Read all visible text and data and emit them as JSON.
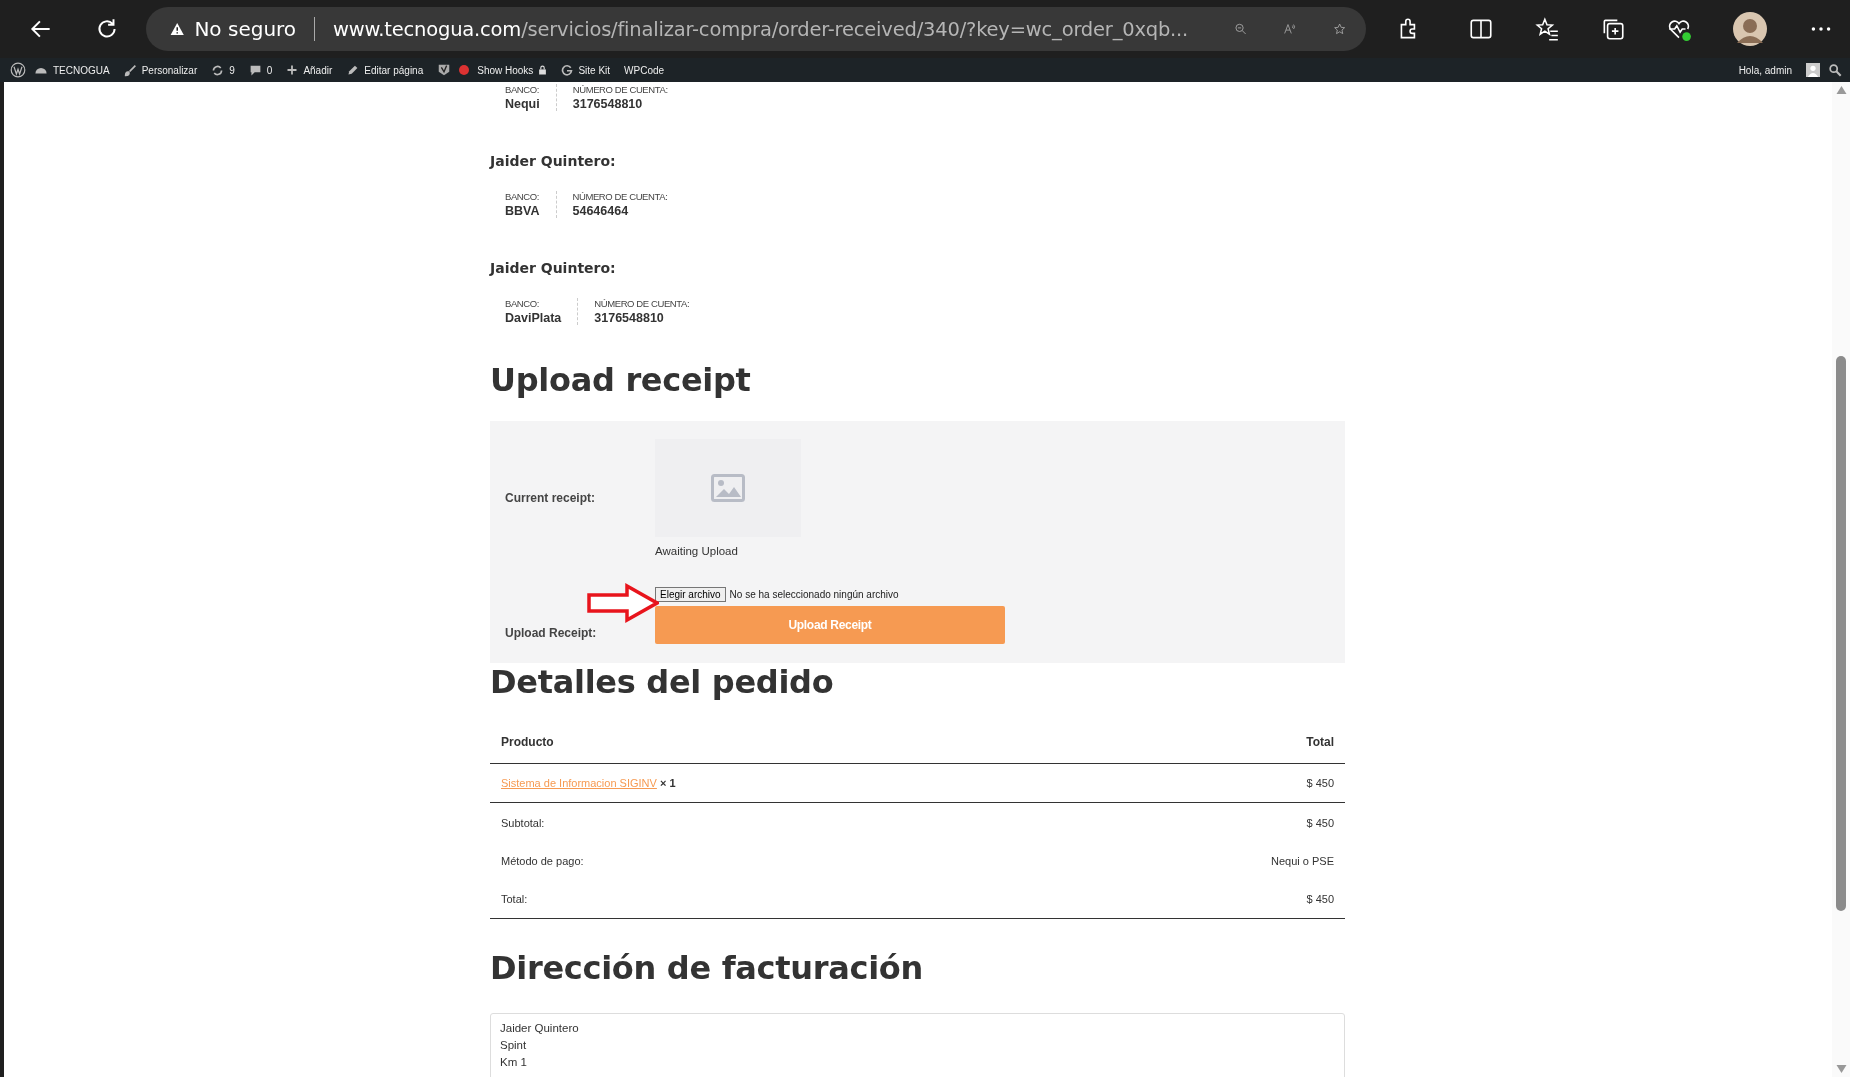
{
  "browser": {
    "security": "No seguro",
    "url_domain": "www.tecnogua.com",
    "url_path": "/servicios/finalizar-compra/order-received/340/?key=wc_order_0xqb..."
  },
  "admin_bar": {
    "site": "TECNOGUA",
    "items": [
      {
        "kind": "brush",
        "label": "Personalizar"
      },
      {
        "kind": "updates",
        "label": "9"
      },
      {
        "kind": "comments",
        "label": "0"
      },
      {
        "kind": "plus",
        "label": "Añadir"
      },
      {
        "kind": "pencil",
        "label": "Editar página"
      },
      {
        "kind": "seo"
      },
      {
        "kind": "dot"
      },
      {
        "kind": "lock",
        "label": "Show Hooks"
      },
      {
        "kind": "g",
        "label": "Site Kit"
      },
      {
        "kind": "text",
        "label": "WPCode"
      }
    ],
    "greeting": "Hola, admin"
  },
  "accounts": [
    {
      "bank_label": "BANCO:",
      "bank": "Nequi",
      "number_label": "NÚMERO DE CUENTA:",
      "number": "3176548810"
    },
    {
      "holder": "Jaider Quintero:",
      "bank_label": "BANCO:",
      "bank": "BBVA",
      "number_label": "NÚMERO DE CUENTA:",
      "number": "54646464"
    },
    {
      "holder": "Jaider Quintero:",
      "bank_label": "BANCO:",
      "bank": "DaviPlata",
      "number_label": "NÚMERO DE CUENTA:",
      "number": "3176548810"
    }
  ],
  "upload": {
    "title": "Upload receipt",
    "current_label": "Current receipt:",
    "status": "Awaiting Upload",
    "upload_label": "Upload Receipt:",
    "file_button": "Elegir archivo",
    "file_status": "No se ha seleccionado ningún archivo",
    "submit": "Upload Receipt"
  },
  "order": {
    "title": "Detalles del pedido",
    "columns": [
      "Producto",
      "Total"
    ],
    "items": [
      {
        "product": "Sistema de Informacion SIGINV",
        "quantity": "× 1",
        "total": "$ 450"
      }
    ],
    "totals": [
      {
        "label": "Subtotal:",
        "value": "$ 450"
      },
      {
        "label": "Método de pago:",
        "value": "Nequi o PSE"
      },
      {
        "label": "Total:",
        "value": "$ 450"
      }
    ]
  },
  "billing": {
    "title": "Dirección de facturación",
    "lines": [
      "Jaider Quintero",
      "Spint",
      "Km 1"
    ]
  }
}
